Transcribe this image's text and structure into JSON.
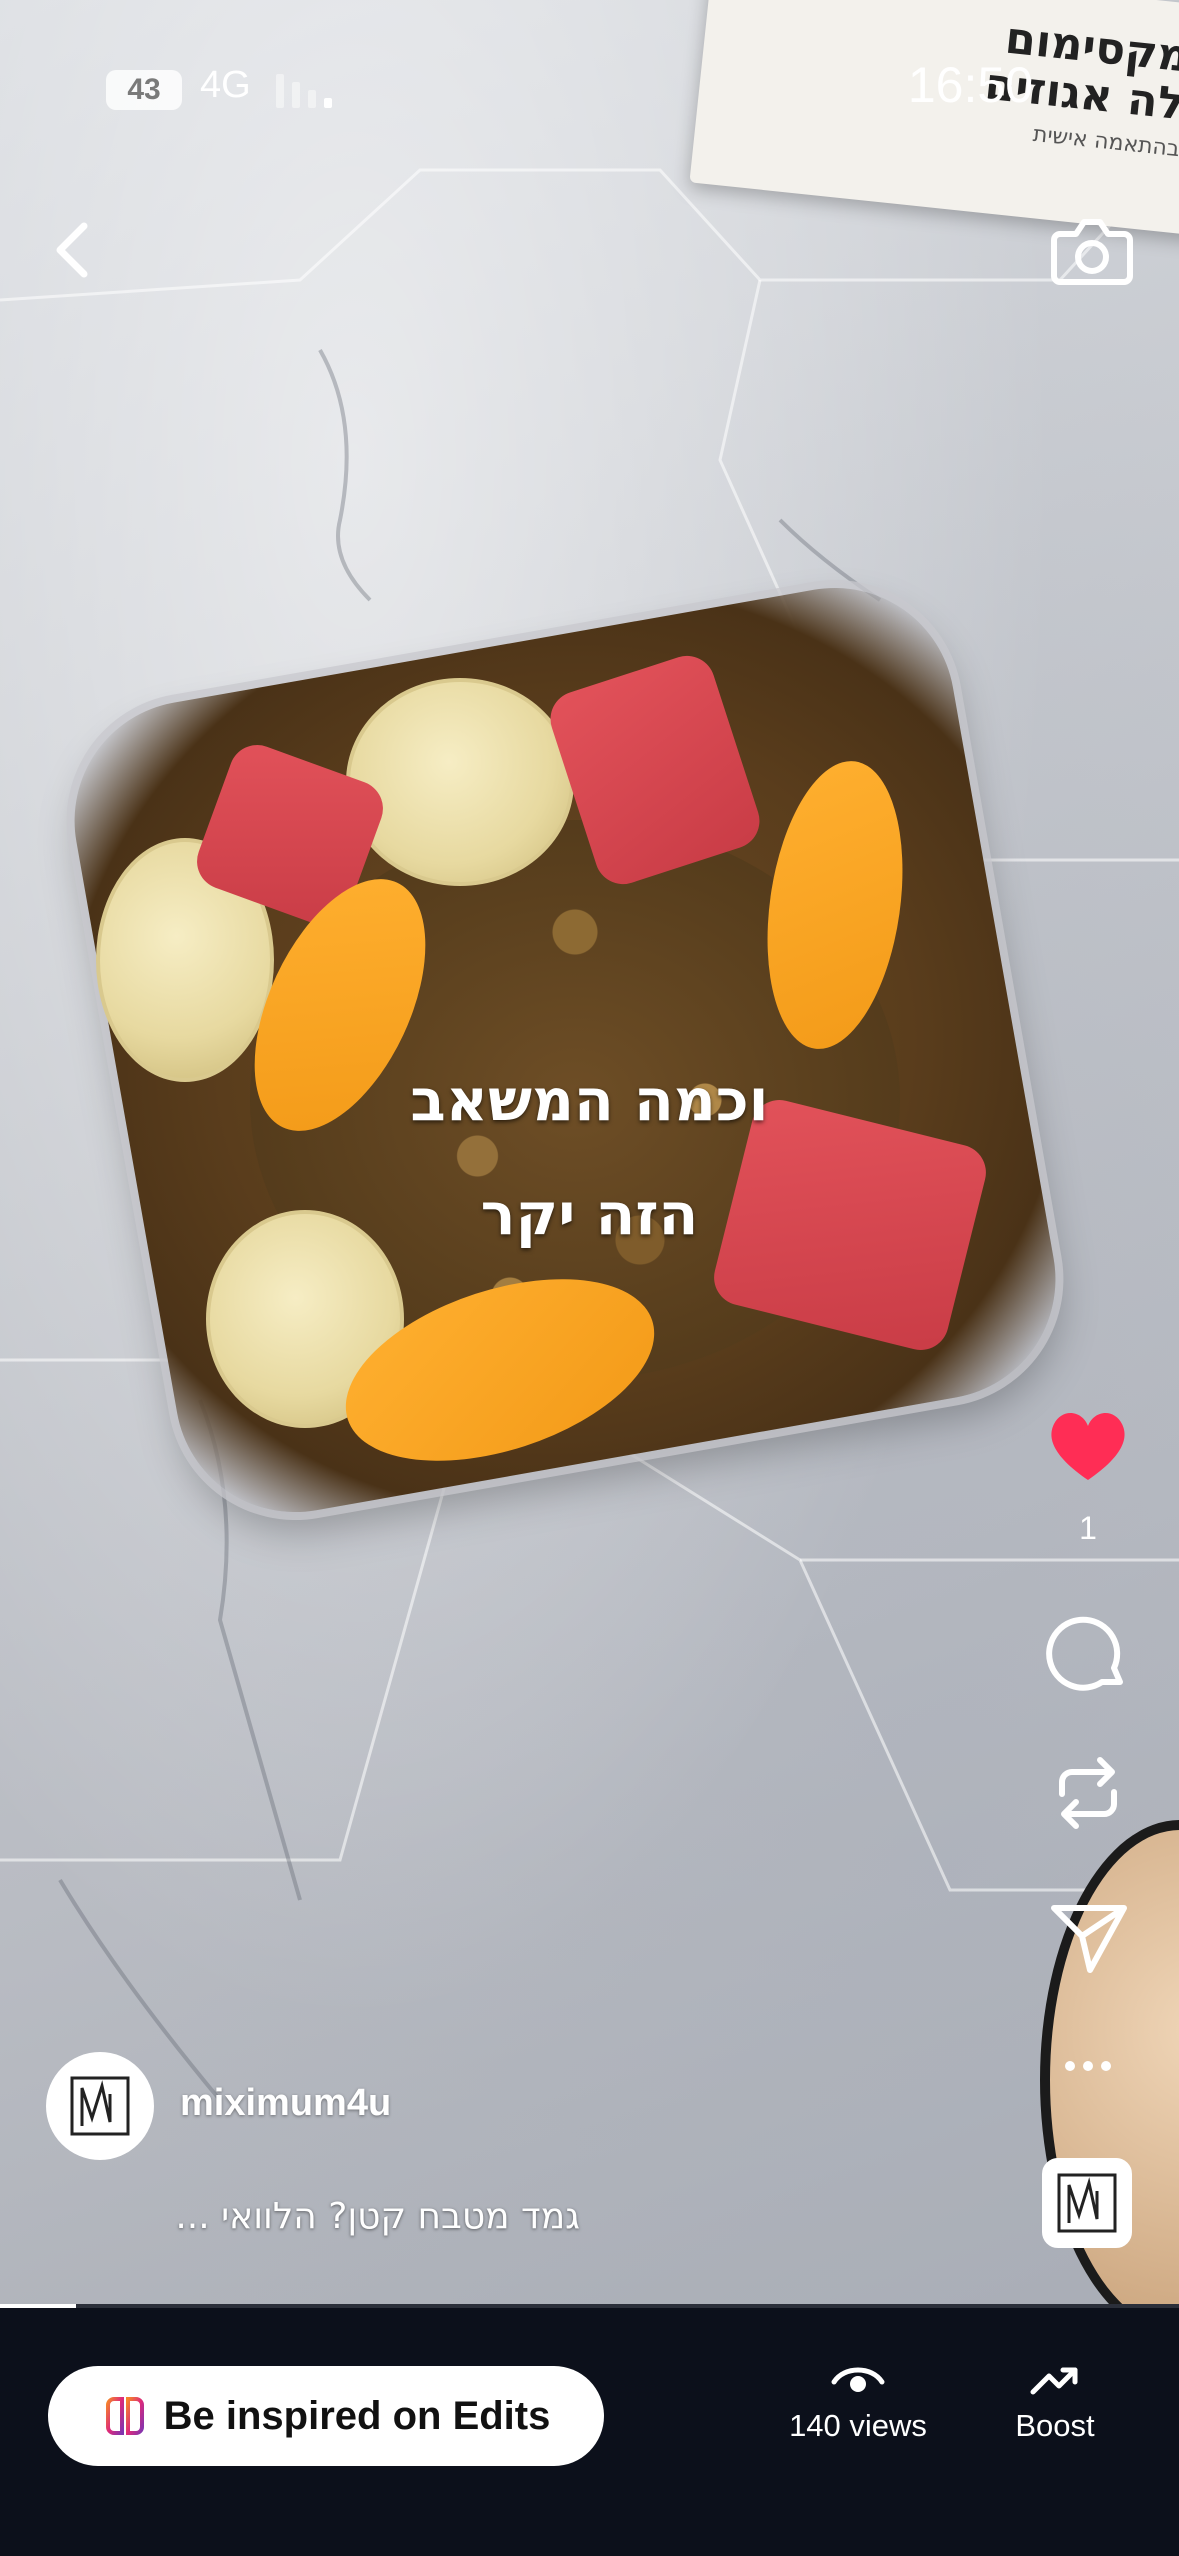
{
  "status_bar": {
    "badge": "43",
    "network": "4G",
    "time": "16:50"
  },
  "paper_card": {
    "line1": "מקסימום",
    "line2": "לה אגוזים",
    "line3": "בהתאמה אישית"
  },
  "video_caption": {
    "line1": "וכמה המשאב",
    "line2": "הזה יקר"
  },
  "right_rail": {
    "likes": "1"
  },
  "author": {
    "username": "miximum4u"
  },
  "caption": "גמד מטבח קטן? הלוואי ...",
  "bottom_bar": {
    "edits_button": "Be inspired on Edits",
    "views_label": "140 views",
    "boost_label": "Boost"
  },
  "colors": {
    "heart": "#ff2d55",
    "bottom_bg": "#0c101b"
  },
  "icons": [
    "back-icon",
    "camera-icon",
    "heart-icon",
    "comment-icon",
    "repost-icon",
    "share-icon",
    "more-icon",
    "eye-icon",
    "trend-up-icon",
    "edits-logo-icon"
  ]
}
